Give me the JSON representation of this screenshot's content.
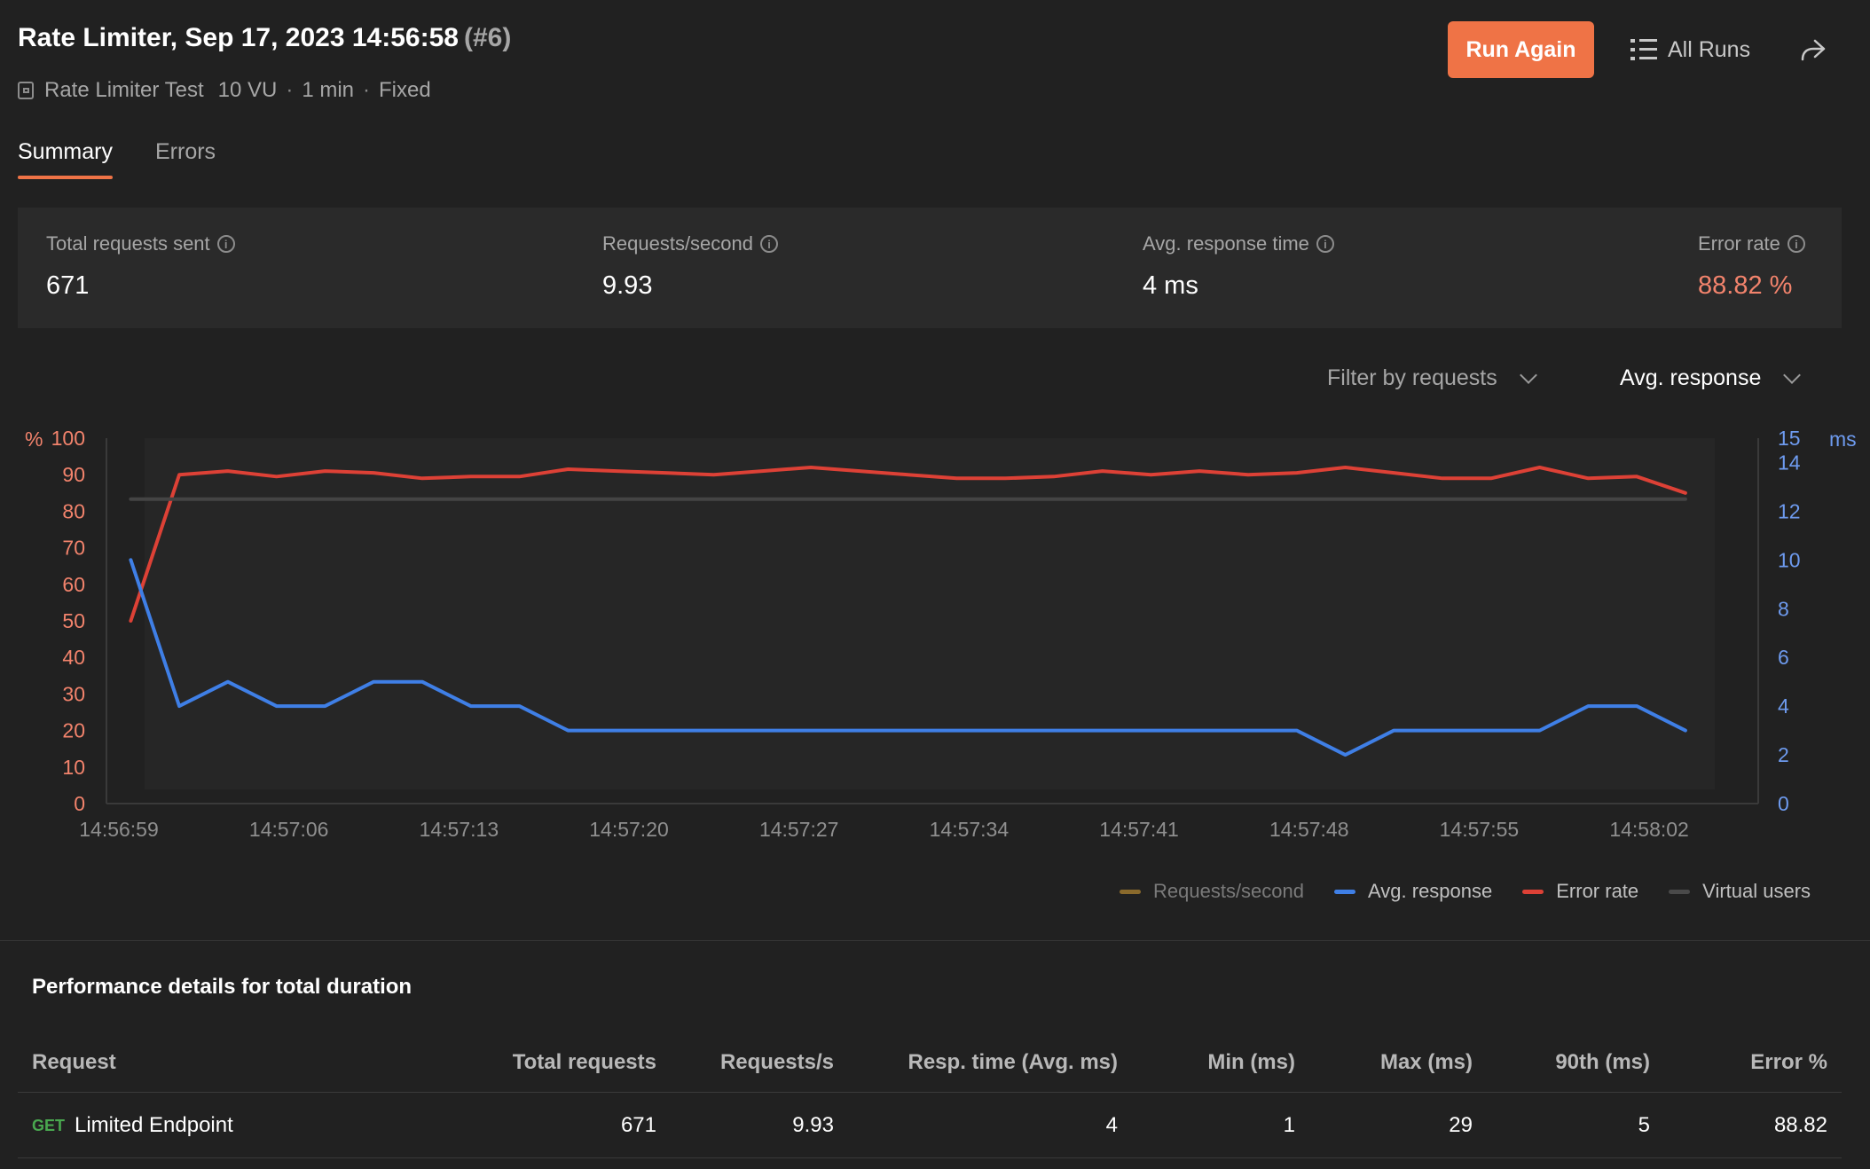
{
  "header": {
    "title": "Rate Limiter, Sep 17, 2023 14:56:58",
    "run_number": "(#6)",
    "collection": "Rate Limiter Test",
    "virtual_users": "10 VU",
    "duration": "1 min",
    "load_profile": "Fixed",
    "separator": "·",
    "run_again_label": "Run Again",
    "all_runs_label": "All Runs"
  },
  "tabs": [
    {
      "label": "Summary",
      "active": true
    },
    {
      "label": "Errors",
      "active": false
    }
  ],
  "stats": [
    {
      "label": "Total requests sent",
      "value": "671"
    },
    {
      "label": "Requests/second",
      "value": "9.93"
    },
    {
      "label": "Avg. response time",
      "value": "4 ms"
    },
    {
      "label": "Error rate",
      "value": "88.82 %"
    }
  ],
  "filters": {
    "filter_label": "Filter by requests",
    "metric_label": "Avg. response"
  },
  "colors": {
    "accent": "#ef7346",
    "error_rate": "#dd4136",
    "avg_response": "#3f7fe6",
    "virtual_users": "#444444",
    "requests_per_second": "#8a6a2c",
    "left_axis_text": "#f2836c",
    "right_axis_text": "#6e9bef",
    "error_value": "#f2836c"
  },
  "chart_data": {
    "type": "line",
    "x_tick_labels": [
      "14:56:59",
      "14:57:06",
      "14:57:13",
      "14:57:20",
      "14:57:27",
      "14:57:34",
      "14:57:41",
      "14:57:48",
      "14:57:55",
      "14:58:02"
    ],
    "x_range_seconds": [
      0,
      68
    ],
    "x_tick_seconds": [
      0,
      7,
      14,
      21,
      28,
      35,
      42,
      49,
      56,
      63
    ],
    "left_axis": {
      "unit": "%",
      "ylim": [
        0,
        100
      ],
      "ticks": [
        0,
        10,
        20,
        30,
        40,
        50,
        60,
        70,
        80,
        90,
        100
      ],
      "tick_labels": [
        "0",
        "10",
        "20",
        "30",
        "40",
        "50",
        "60",
        "70",
        "80",
        "90",
        "100"
      ]
    },
    "right_axis": {
      "unit": "ms",
      "ylim": [
        0,
        15
      ],
      "ticks": [
        0,
        2,
        4,
        6,
        8,
        10,
        12,
        14,
        15
      ],
      "tick_labels": [
        "0",
        "2",
        "4",
        "6",
        "8",
        "10",
        "12",
        "14",
        "15"
      ]
    },
    "series": [
      {
        "name": "Error rate",
        "axis": "left",
        "color": "#dd4136",
        "x": [
          1,
          3,
          5,
          7,
          9,
          11,
          13,
          15,
          17,
          19,
          21,
          23,
          25,
          27,
          29,
          31,
          33,
          35,
          37,
          39,
          41,
          43,
          45,
          47,
          49,
          51,
          53,
          55,
          57,
          59,
          61,
          63,
          65
        ],
        "values": [
          50,
          90,
          91,
          89.5,
          91,
          90.5,
          89,
          89.5,
          89.5,
          91.5,
          91,
          90.5,
          90,
          91,
          92,
          91,
          90,
          89,
          89,
          89.5,
          91,
          90,
          91,
          90,
          90.5,
          92,
          90.5,
          89,
          89,
          92,
          89,
          89.5,
          85
        ]
      },
      {
        "name": "Avg. response",
        "axis": "right",
        "color": "#3f7fe6",
        "x": [
          1,
          3,
          5,
          7,
          9,
          11,
          13,
          15,
          17,
          19,
          21,
          23,
          25,
          27,
          29,
          31,
          33,
          35,
          37,
          39,
          41,
          43,
          45,
          47,
          49,
          51,
          53,
          55,
          57,
          59,
          61,
          63,
          65
        ],
        "values": [
          10,
          4,
          5,
          4,
          4,
          5,
          5,
          4,
          4,
          3,
          3,
          3,
          3,
          3,
          3,
          3,
          3,
          3,
          3,
          3,
          3,
          3,
          3,
          3,
          3,
          2,
          3,
          3,
          3,
          3,
          4,
          4,
          3
        ]
      },
      {
        "name": "Virtual users",
        "axis": "right",
        "color": "#444444",
        "x": [
          1,
          65
        ],
        "values": [
          12.5,
          12.5
        ]
      }
    ],
    "legend": [
      "Requests/second",
      "Avg. response",
      "Error rate",
      "Virtual users"
    ],
    "legend_placement": "bottom-right",
    "grid": false
  },
  "performance": {
    "title": "Performance details for total duration",
    "columns": [
      "Request",
      "Total requests",
      "Requests/s",
      "Resp. time (Avg. ms)",
      "Min (ms)",
      "Max (ms)",
      "90th (ms)",
      "Error %"
    ],
    "rows": [
      {
        "method": "GET",
        "name": "Limited Endpoint",
        "total": "671",
        "rps": "9.93",
        "avg": "4",
        "min": "1",
        "max": "29",
        "p90": "5",
        "error": "88.82"
      }
    ]
  }
}
